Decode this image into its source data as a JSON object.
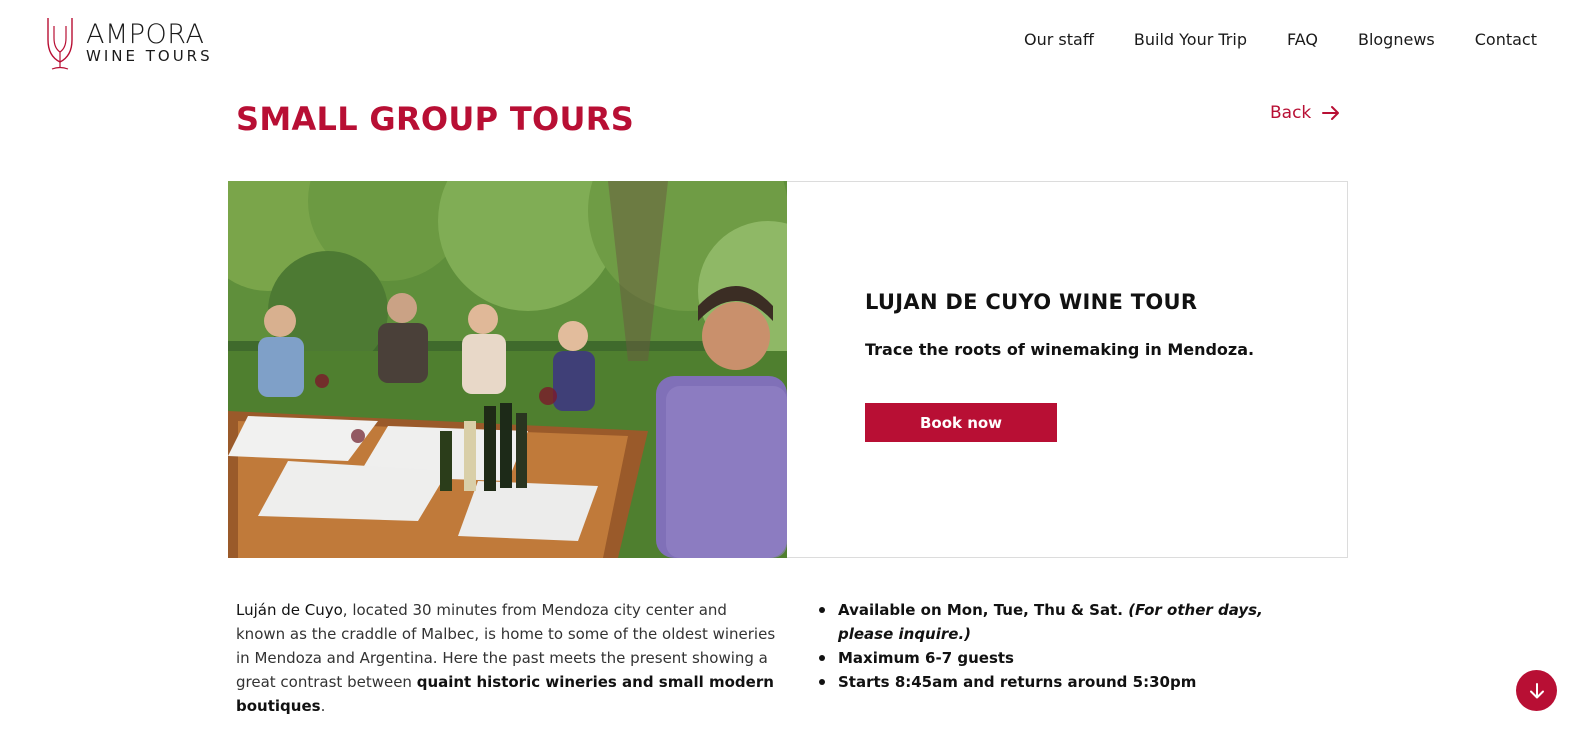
{
  "brand": {
    "name_line1": "AMPORA",
    "name_line2": "WINE TOURS",
    "accent_color": "#b80f34"
  },
  "nav": {
    "items": [
      {
        "label": "Our staff"
      },
      {
        "label": "Build Your Trip"
      },
      {
        "label": "FAQ"
      },
      {
        "label": "Blognews"
      },
      {
        "label": "Contact"
      }
    ]
  },
  "page": {
    "title": "SMALL GROUP TOURS",
    "back_label": "Back",
    "back_icon": "arrow-right-icon"
  },
  "tour": {
    "photo_icon": "tour-photo",
    "title": "LUJAN DE CUYO WINE TOUR",
    "tagline": "Trace the roots of winemaking in Mendoza.",
    "book_label": "Book now"
  },
  "description": {
    "place": "Luján de Cuyo",
    "text1": ", located 30 minutes from Mendoza city center and known as the craddle of Malbec, is home to some of the oldest wineries in Mendoza and Argentina. Here the past meets the present showing a great contrast between ",
    "highlight": "quaint historic wineries and small modern boutiques",
    "text2": "."
  },
  "facts": {
    "availability": "Available on Mon, Tue, Thu & Sat. ",
    "availability_note": "(For other days, please inquire.)",
    "guests": "Maximum 6-7 guests",
    "schedule": "Starts 8:45am and returns around 5:30pm"
  },
  "scroll_button": {
    "icon": "arrow-down-icon"
  }
}
